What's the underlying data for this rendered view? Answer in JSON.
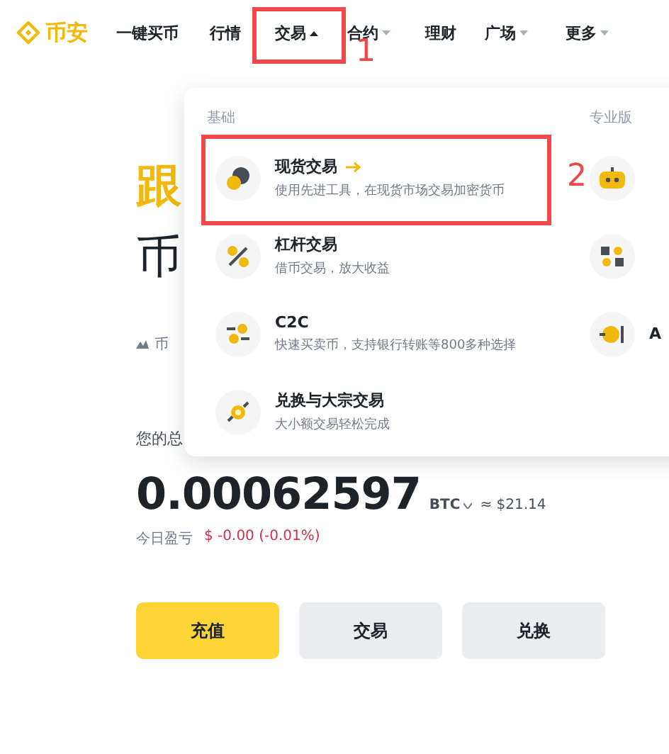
{
  "logo": {
    "text": "币安"
  },
  "nav": [
    {
      "label": "一键买币"
    },
    {
      "label": "行情"
    },
    {
      "label": "交易",
      "expanded": true
    },
    {
      "label": "合约",
      "expanded": false
    },
    {
      "label": "理财"
    },
    {
      "label": "广场",
      "expanded": false
    },
    {
      "label": "更多",
      "expanded": false
    }
  ],
  "hero": {
    "headline_fragment": "跟",
    "subheadline_fragment": "币",
    "tagline_fragment": "币",
    "balance_label_fragment": "您的总"
  },
  "dropdown": {
    "basic_heading": "基础",
    "pro_heading": "专业版",
    "basic_items": [
      {
        "title": "现货交易",
        "description": "使用先进工具，在现货市场交易加密货币",
        "arrow": true
      },
      {
        "title": "杠杆交易",
        "description": "借币交易，放大收益",
        "arrow": false
      },
      {
        "title": "C2C",
        "description": "快速买卖币，支持银行转账等800多种选择",
        "arrow": false
      },
      {
        "title": "兑换与大宗交易",
        "description": "大小额交易轻松完成",
        "arrow": false
      }
    ],
    "pro_title_fragment": "A"
  },
  "balance": {
    "amount": "0.00062597",
    "unit": "BTC",
    "fiat": "≈ $21.14",
    "pnl_label": "今日盈亏",
    "pnl_value": "$ -0.00 (-0.01%)"
  },
  "buttons": [
    {
      "label": "充值",
      "primary": true
    },
    {
      "label": "交易",
      "primary": false
    },
    {
      "label": "兑换",
      "primary": false
    }
  ],
  "annotations": [
    {
      "label": "1"
    },
    {
      "label": "2"
    }
  ]
}
